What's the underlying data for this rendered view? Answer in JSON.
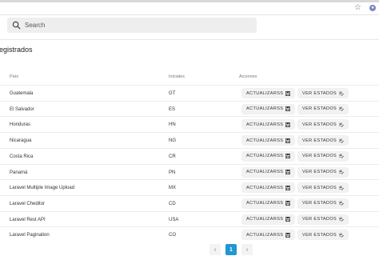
{
  "search": {
    "placeholder": "Search"
  },
  "page": {
    "title": "egistrados"
  },
  "table": {
    "headers": {
      "country": "País",
      "initials": "Iniciales",
      "actions": "Acciones"
    },
    "update_label": "ACTUALIZARSS",
    "states_label": "VER ESTADOS",
    "rows": [
      {
        "country": "Guatemala",
        "initials": "GT"
      },
      {
        "country": "El Salvador",
        "initials": "ES"
      },
      {
        "country": "Honduras",
        "initials": "HN"
      },
      {
        "country": "Nicaragua",
        "initials": "NG"
      },
      {
        "country": "Costa Rica",
        "initials": "CR"
      },
      {
        "country": "Panamá",
        "initials": "PN"
      },
      {
        "country": "Laravel Multiple Image Upload",
        "initials": "MX"
      },
      {
        "country": "Laravel Cheditor",
        "initials": "CD"
      },
      {
        "country": "Laravel Rest API",
        "initials": "USA"
      },
      {
        "country": "Laravel Pagination",
        "initials": "CO"
      }
    ]
  },
  "pagination": {
    "prev": "‹",
    "current": "1",
    "next": "›"
  },
  "colors": {
    "accent": "#2196d3"
  },
  "icons": {
    "browser": [
      "star-icon",
      "extension-icon"
    ],
    "search": "search-icon",
    "update": "save-icon",
    "states": "list-edit-icon"
  }
}
